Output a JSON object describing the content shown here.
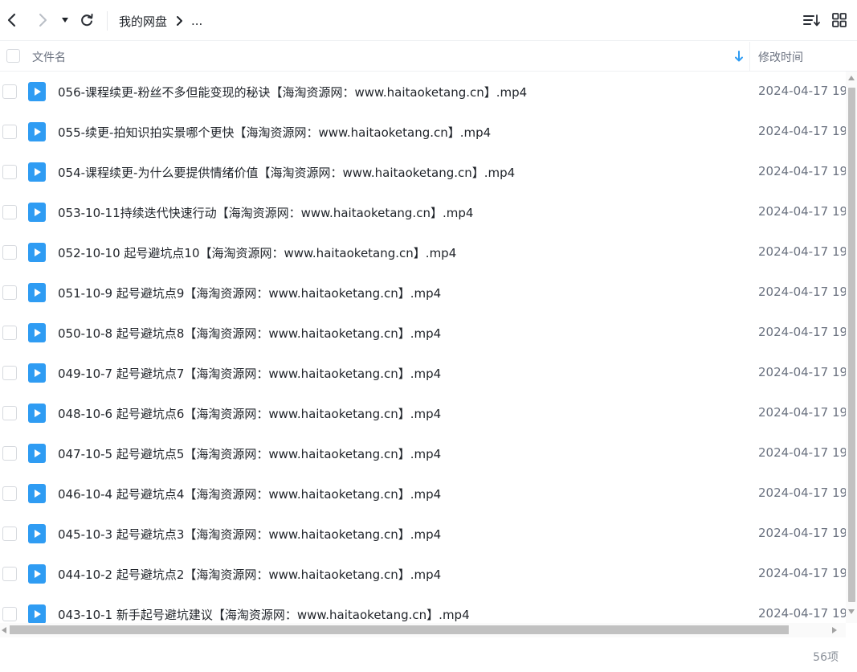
{
  "toolbar": {
    "back_icon": "chevron-left-icon",
    "forward_icon": "chevron-right-icon",
    "history_icon": "caret-down-icon",
    "refresh_icon": "refresh-icon",
    "sort_icon": "sort-list-icon",
    "view_icon": "grid-view-icon"
  },
  "breadcrumb": {
    "root": "我的网盘",
    "separator_icon": "chevron-right-icon",
    "more": "..."
  },
  "header": {
    "name_label": "文件名",
    "time_label": "修改时间",
    "sort_icon": "arrow-down-icon"
  },
  "files": [
    {
      "name": "056-课程续更-粉丝不多但能变现的秘诀【海淘资源网：www.haitaoketang.cn】.mp4",
      "time": "2024-04-17 19"
    },
    {
      "name": "055-续更-拍知识拍实景哪个更快【海淘资源网：www.haitaoketang.cn】.mp4",
      "time": "2024-04-17 19"
    },
    {
      "name": "054-课程续更-为什么要提供情绪价值【海淘资源网：www.haitaoketang.cn】.mp4",
      "time": "2024-04-17 19"
    },
    {
      "name": "053-10-11持续迭代快速行动【海淘资源网：www.haitaoketang.cn】.mp4",
      "time": "2024-04-17 19"
    },
    {
      "name": "052-10-10 起号避坑点10【海淘资源网：www.haitaoketang.cn】.mp4",
      "time": "2024-04-17 19"
    },
    {
      "name": "051-10-9 起号避坑点9【海淘资源网：www.haitaoketang.cn】.mp4",
      "time": "2024-04-17 19"
    },
    {
      "name": "050-10-8 起号避坑点8【海淘资源网：www.haitaoketang.cn】.mp4",
      "time": "2024-04-17 19"
    },
    {
      "name": "049-10-7 起号避坑点7【海淘资源网：www.haitaoketang.cn】.mp4",
      "time": "2024-04-17 19"
    },
    {
      "name": "048-10-6 起号避坑点6【海淘资源网：www.haitaoketang.cn】.mp4",
      "time": "2024-04-17 19"
    },
    {
      "name": "047-10-5 起号避坑点5【海淘资源网：www.haitaoketang.cn】.mp4",
      "time": "2024-04-17 19"
    },
    {
      "name": "046-10-4 起号避坑点4【海淘资源网：www.haitaoketang.cn】.mp4",
      "time": "2024-04-17 19"
    },
    {
      "name": "045-10-3 起号避坑点3【海淘资源网：www.haitaoketang.cn】.mp4",
      "time": "2024-04-17 19"
    },
    {
      "name": "044-10-2 起号避坑点2【海淘资源网：www.haitaoketang.cn】.mp4",
      "time": "2024-04-17 19"
    },
    {
      "name": "043-10-1 新手起号避坑建议【海淘资源网：www.haitaoketang.cn】.mp4",
      "time": "2024-04-17 19"
    }
  ],
  "file_icon": "video-file-icon",
  "footer": {
    "count": "56项"
  },
  "colors": {
    "accent": "#2f9cf3",
    "text": "#1f2329",
    "muted": "#6b7280"
  }
}
